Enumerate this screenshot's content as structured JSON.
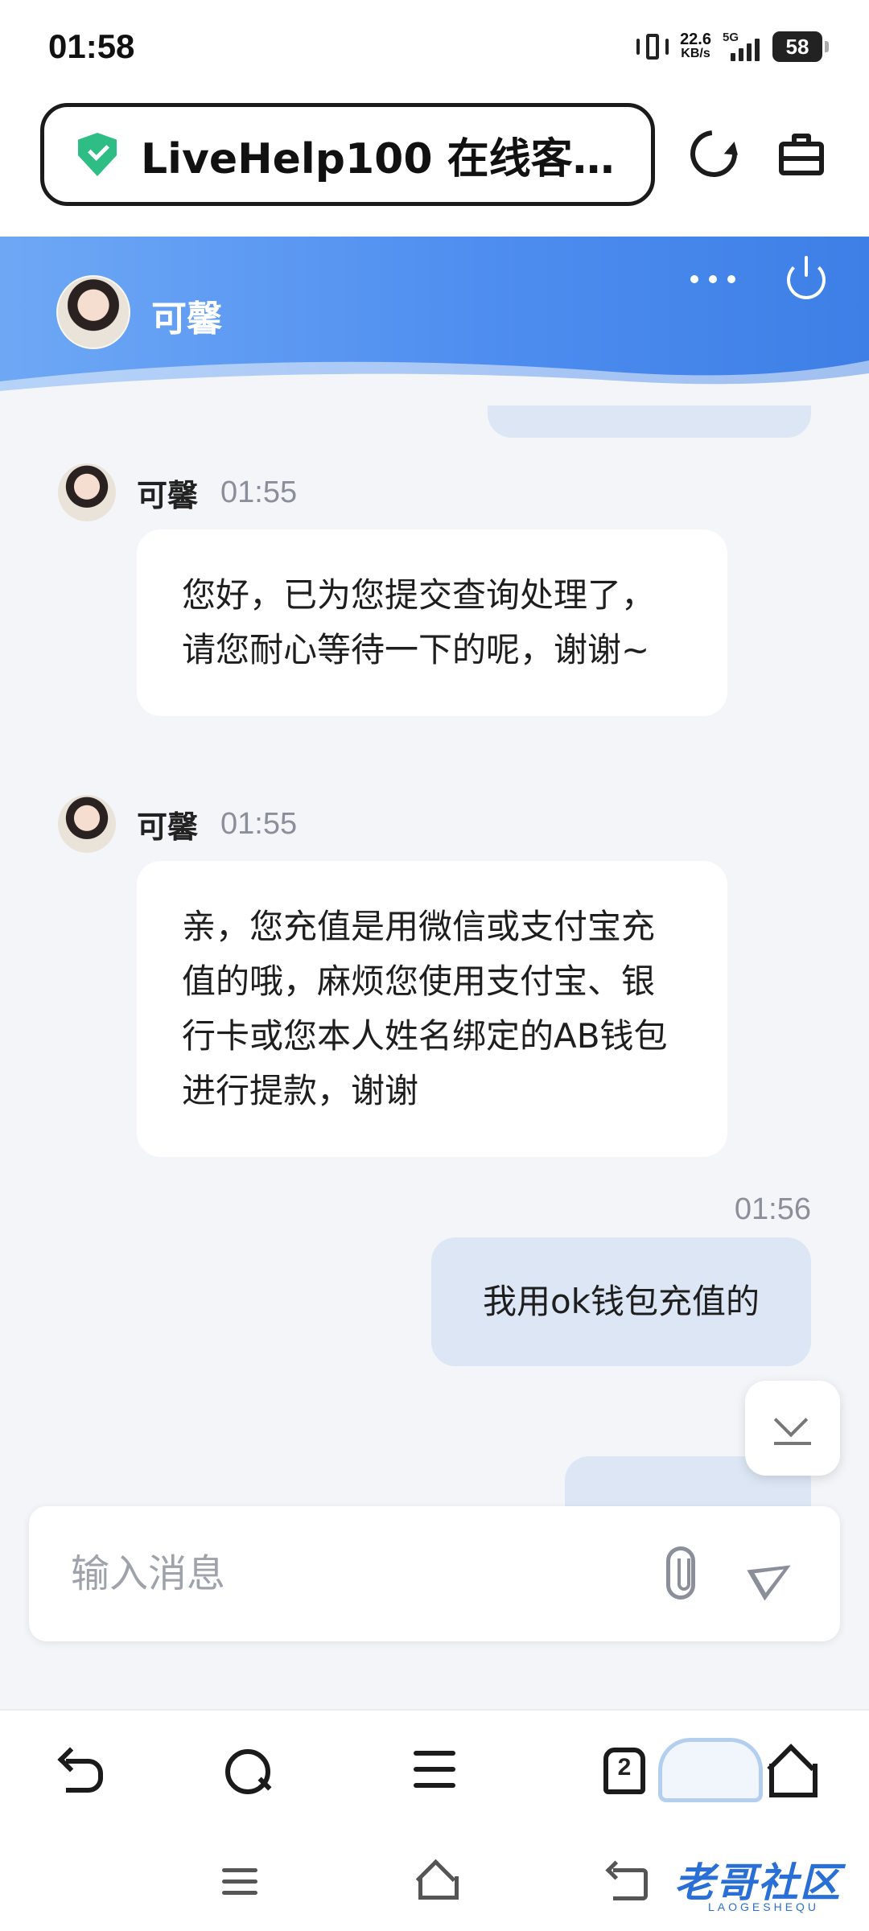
{
  "status_bar": {
    "time": "01:58",
    "speed_value": "22.6",
    "speed_unit": "KB/s",
    "network": "5G",
    "battery": "58"
  },
  "browser": {
    "url_title": "LiveHelp100 在线客…",
    "icons": [
      "shield-check-icon",
      "reload-icon",
      "toolbox-icon"
    ]
  },
  "chat_header": {
    "agent_name": "可馨",
    "icons": [
      "more-icon",
      "power-icon"
    ]
  },
  "messages": [
    {
      "sender": "可馨",
      "time": "01:55",
      "text": "您好，已为您提交查询处理了，请您耐心等待一下的呢，谢谢~"
    },
    {
      "sender": "可馨",
      "time": "01:55",
      "text": "亲，您充值是用微信或支付宝充值的哦，麻烦您使用支付宝、银行卡或您本人姓名绑定的AB钱包进行提款，谢谢"
    },
    {
      "sender": "me",
      "time": "01:56",
      "text": "我用ok钱包充值的"
    },
    {
      "sender": "me",
      "time": "0",
      "text": ""
    }
  ],
  "input": {
    "placeholder": "输入消息"
  },
  "bottom_nav": {
    "tab_count": "2",
    "icons": [
      "back-icon",
      "search-icon",
      "menu-icon",
      "tabs-icon",
      "home-icon"
    ]
  },
  "watermark": {
    "text": "老哥社区",
    "sub": "LAOGESHEQU"
  },
  "colors": {
    "header_gradient_start": "#6ea8f5",
    "header_gradient_end": "#3d7fe6",
    "outgoing_bubble": "#dce6f4",
    "incoming_bubble": "#ffffff",
    "shield_green": "#2ebd85"
  }
}
